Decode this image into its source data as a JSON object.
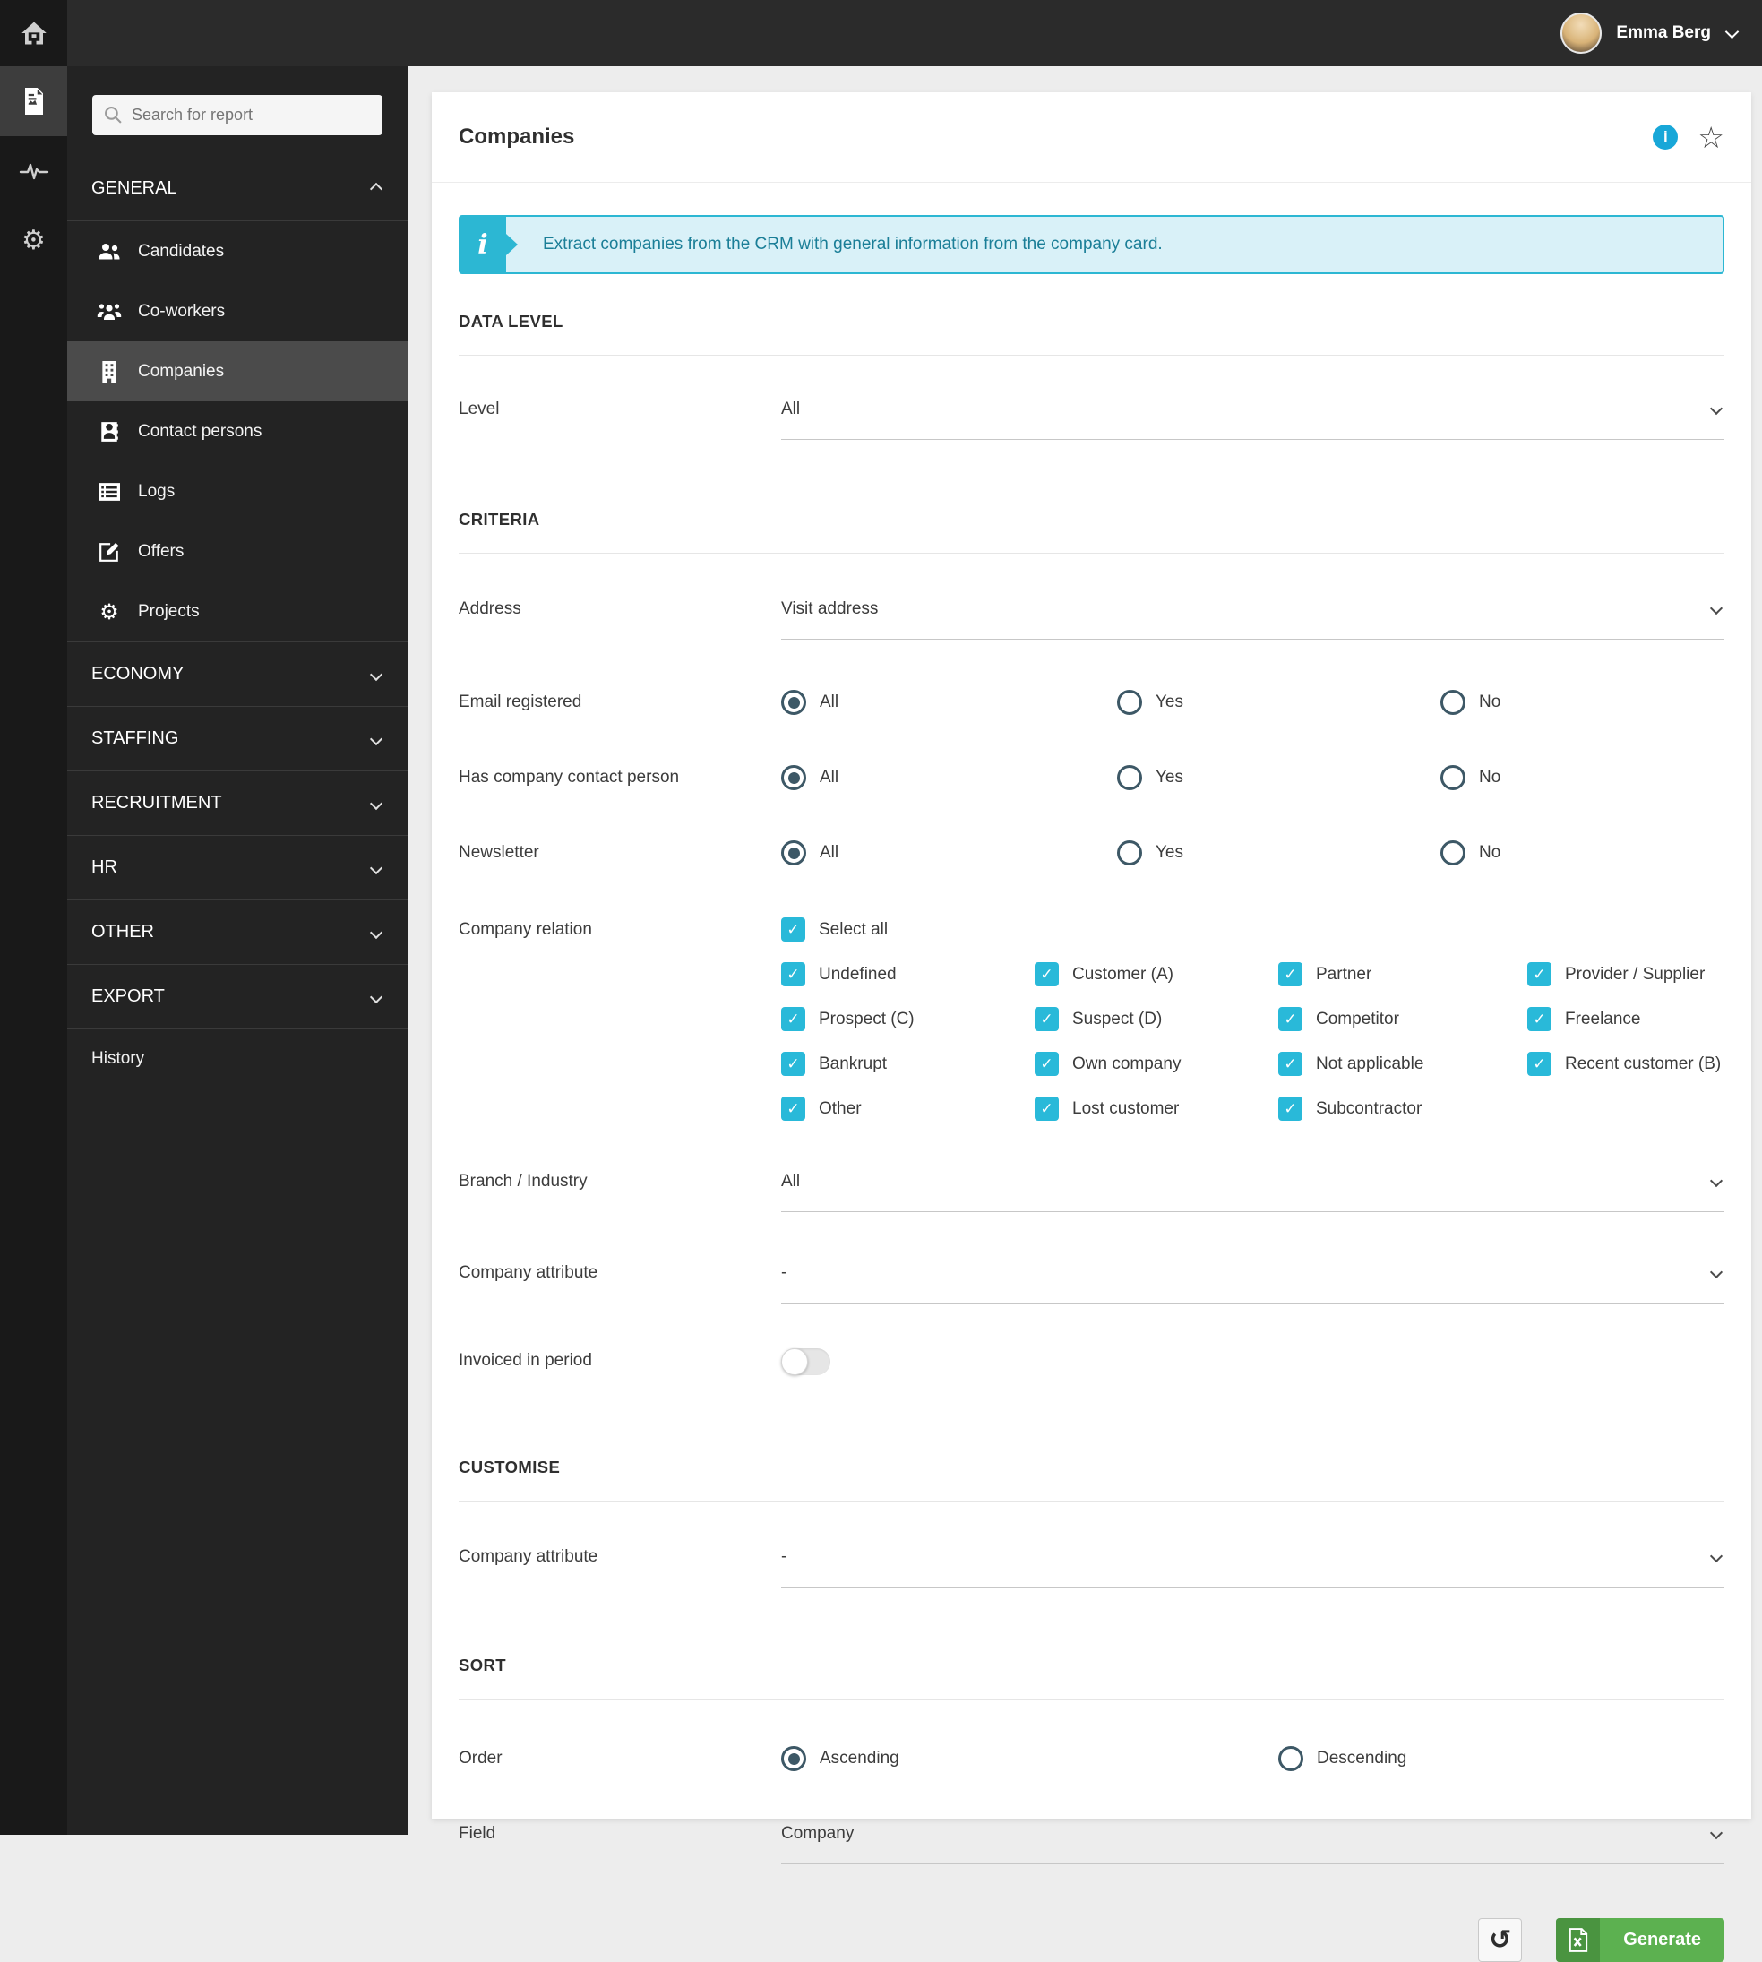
{
  "topbar": {
    "user_name": "Emma Berg"
  },
  "sidebar": {
    "search_placeholder": "Search for report",
    "sections": [
      {
        "label": "GENERAL",
        "items": [
          {
            "label": "Candidates"
          },
          {
            "label": "Co-workers"
          },
          {
            "label": "Companies"
          },
          {
            "label": "Contact persons"
          },
          {
            "label": "Logs"
          },
          {
            "label": "Offers"
          },
          {
            "label": "Projects"
          }
        ]
      },
      {
        "label": "ECONOMY"
      },
      {
        "label": "STAFFING"
      },
      {
        "label": "RECRUITMENT"
      },
      {
        "label": "HR"
      },
      {
        "label": "OTHER"
      },
      {
        "label": "EXPORT"
      }
    ],
    "history_label": "History"
  },
  "main": {
    "title": "Companies",
    "banner": {
      "text": "Extract companies from the CRM with general information from the company card."
    },
    "data_level": {
      "title": "DATA LEVEL",
      "level_label": "Level",
      "level_value": "All"
    },
    "criteria": {
      "title": "CRITERIA",
      "address_label": "Address",
      "address_value": "Visit address",
      "email_label": "Email registered",
      "contact_label": "Has company contact person",
      "newsletter_label": "Newsletter",
      "radio_all": "All",
      "radio_yes": "Yes",
      "radio_no": "No",
      "relation_label": "Company relation",
      "select_all": "Select all",
      "relations": [
        "Undefined",
        "Customer (A)",
        "Partner",
        "Provider / Supplier",
        "Prospect (C)",
        "Suspect (D)",
        "Competitor",
        "Freelance",
        "Bankrupt",
        "Own company",
        "Not applicable",
        "Recent customer (B)",
        "Other",
        "Lost customer",
        "Subcontractor"
      ],
      "branch_label": "Branch / Industry",
      "branch_value": "All",
      "attribute_label": "Company attribute",
      "attribute_value": "-",
      "invoiced_label": "Invoiced in period"
    },
    "customise": {
      "title": "CUSTOMISE",
      "attribute_label": "Company attribute",
      "attribute_value": "-"
    },
    "sort": {
      "title": "SORT",
      "order_label": "Order",
      "ascending": "Ascending",
      "descending": "Descending",
      "field_label": "Field",
      "field_value": "Company"
    },
    "actions": {
      "generate_label": "Generate"
    },
    "colors": {
      "accent_cyan": "#29b9d9",
      "banner_teal": "#1a7e97",
      "generate_green": "#5cb150",
      "radio_slate": "#3d5866"
    }
  }
}
